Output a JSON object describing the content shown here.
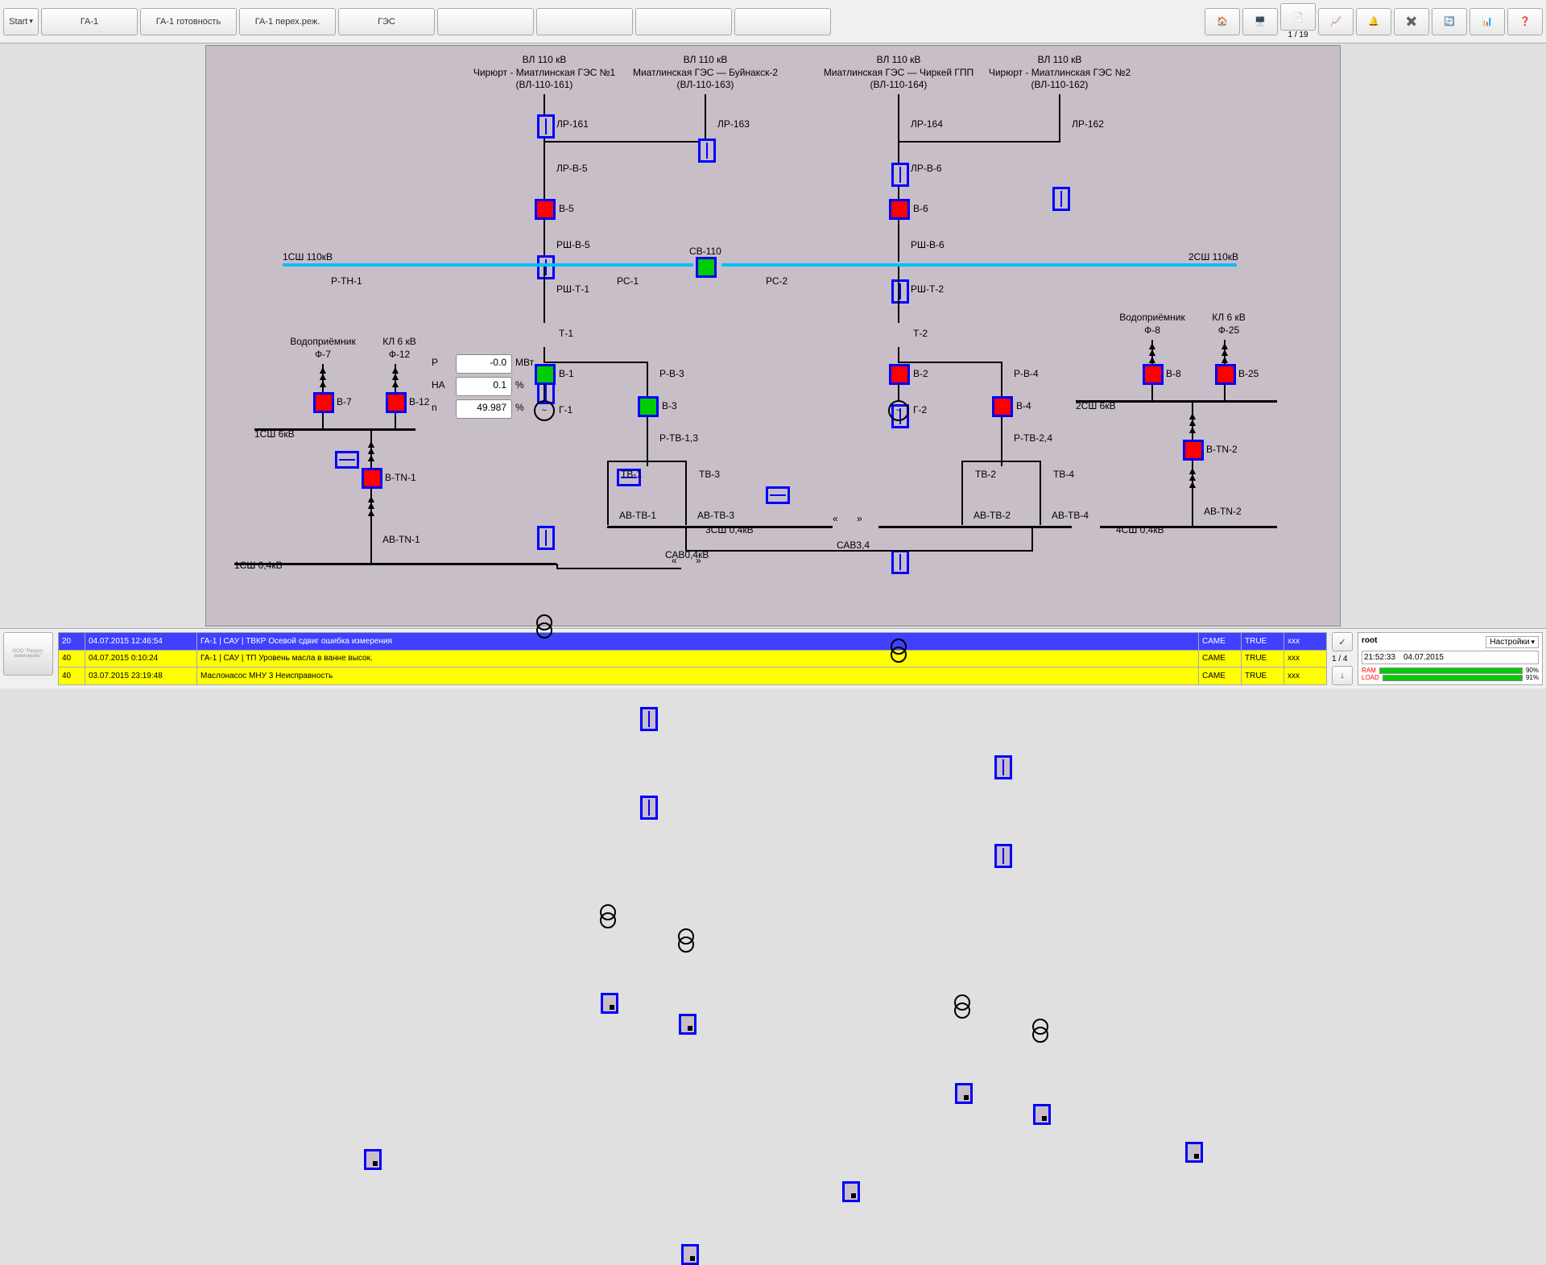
{
  "toolbar": {
    "start": "Start",
    "buttons": [
      "ГА-1",
      "ГА-1 готовность",
      "ГА-1 перех.реж.",
      "ГЭС",
      "",
      "",
      "",
      ""
    ],
    "page_counter": "1 / 19"
  },
  "headers": {
    "vl110_1": {
      "line1": "ВЛ 110 кВ",
      "line2": "Чирюрт - Миатлинская ГЭС №1",
      "line3": "(ВЛ-110-161)"
    },
    "vl110_2": {
      "line1": "ВЛ 110 кВ",
      "line2": "Миатлинская ГЭС — Буйнакск-2",
      "line3": "(ВЛ-110-163)"
    },
    "vl110_3": {
      "line1": "ВЛ 110 кВ",
      "line2": "Миатлинская ГЭС — Чиркей ГПП",
      "line3": "(ВЛ-110-164)"
    },
    "vl110_4": {
      "line1": "ВЛ 110 кВ",
      "line2": "Чирюрт - Миатлинская ГЭС №2",
      "line3": "(ВЛ-110-162)"
    }
  },
  "disconnectors": {
    "lr161": "ЛР-161",
    "lr163": "ЛР-163",
    "lr164": "ЛР-164",
    "lr162": "ЛР-162",
    "lrv5": "ЛР-В-5",
    "lrv6": "ЛР-В-6",
    "rshv5": "РШ-В-5",
    "rshv6": "РШ-В-6",
    "rsht1": "РШ-Т-1",
    "rsht2": "РШ-Т-2",
    "rc1": "РС-1",
    "rc2": "РС-2",
    "rtn1": "Р-ТН-1",
    "rv3": "Р-В-3",
    "rv4": "Р-В-4",
    "rtv13": "Р-ТВ-1,3",
    "rtv24": "Р-ТВ-2,4"
  },
  "breakers": {
    "v5": "В-5",
    "v6": "В-6",
    "sv110": "СВ-110",
    "v1": "В-1",
    "v2": "В-2",
    "v3": "В-3",
    "v4": "В-4",
    "v7": "В-7",
    "v12": "В-12",
    "v8": "В-8",
    "v25": "В-25",
    "vtn1": "В-ТN-1",
    "vtn2": "В-ТN-2",
    "avtn1": "АВ-ТN-1",
    "avtn2": "АВ-ТN-2",
    "avtv1": "АВ-ТВ-1",
    "avtv2": "АВ-ТВ-2",
    "avtv3": "АВ-ТВ-3",
    "avtv4": "АВ-ТВ-4",
    "sav04": "САВ0,4кВ",
    "sav34": "САВ3,4"
  },
  "transformers": {
    "t1": "Т-1",
    "t2": "Т-2",
    "g1": "Г-1",
    "g2": "Г-2",
    "tv1": "ТВ-1",
    "tv2": "ТВ-2",
    "tv3": "ТВ-3",
    "tv4": "ТВ-4"
  },
  "buses": {
    "b1sh110": "1СШ 110кВ",
    "b2sh110": "2СШ 110кВ",
    "b1sh6": "1СШ 6кВ",
    "b2sh6": "2СШ 6кВ",
    "b1sh04": "1СШ 0,4кВ",
    "b3sh04": "3СШ 0,4кВ",
    "b4sh04": "4СШ 0,4кВ"
  },
  "feeders": {
    "vodo7": {
      "l1": "Водоприёмник",
      "l2": "Ф-7"
    },
    "kl12": {
      "l1": "КЛ 6 кВ",
      "l2": "Ф-12"
    },
    "vodo8": {
      "l1": "Водоприёмник",
      "l2": "Ф-8"
    },
    "kl25": {
      "l1": "КЛ 6 кВ",
      "l2": "Ф-25"
    }
  },
  "measurements": {
    "p": {
      "label": "P",
      "value": "-0.0",
      "unit": "МВт"
    },
    "ha": {
      "label": "НА",
      "value": "0.1",
      "unit": "%"
    },
    "n": {
      "label": "n",
      "value": "49.987",
      "unit": "%"
    }
  },
  "alarms": {
    "rows": [
      {
        "cls": "blue",
        "pri": "20",
        "ts": "04.07.2015 12:46:54",
        "msg": "ГА-1 | САУ | ТВКР Осевой сдвиг ошибка измерения",
        "s1": "CAME",
        "s2": "TRUE",
        "s3": "xxx"
      },
      {
        "cls": "yellow",
        "pri": "40",
        "ts": "04.07.2015 0:10:24",
        "msg": "ГА-1 | САУ | ТП Уровень масла в ванне высок.",
        "s1": "CAME",
        "s2": "TRUE",
        "s3": "xxx"
      },
      {
        "cls": "yellow",
        "pri": "40",
        "ts": "03.07.2015 23:19:48",
        "msg": "Маслонасос МНУ 3 Неисправность",
        "s1": "CAME",
        "s2": "TRUE",
        "s3": "xxx"
      }
    ],
    "page": "1 / 4"
  },
  "status": {
    "user": "root",
    "settings": "Настройки",
    "time": "21:52:33",
    "date": "04.07.2015",
    "ram": "RAM",
    "load": "LOAD",
    "ram_pct": "90%",
    "load_pct": "91%"
  },
  "logo": "ООО \"Ракурс-инжиниринг\""
}
